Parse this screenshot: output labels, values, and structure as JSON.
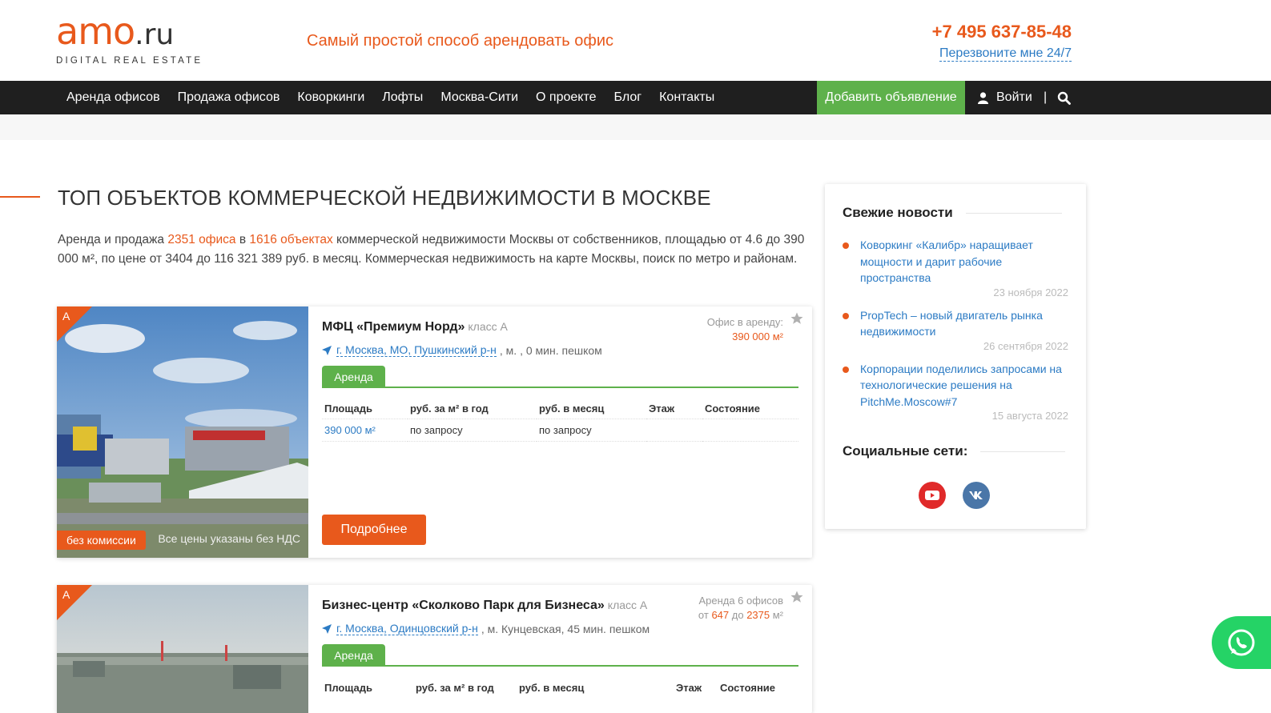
{
  "header": {
    "logo_main": "amo",
    "logo_ru": ".ru",
    "logo_sub": "DIGITAL REAL ESTATE",
    "slogan": "Самый простой способ арендовать офис",
    "phone": "+7 495 637-85-48",
    "callback": "Перезвоните мне 24/7"
  },
  "nav": {
    "items": [
      "Аренда офисов",
      "Продажа офисов",
      "Коворкинги",
      "Лофты",
      "Москва-Сити",
      "О проекте",
      "Блог",
      "Контакты"
    ],
    "add_listing": "Добавить объявление",
    "login": "Войти",
    "separator": "|"
  },
  "main": {
    "title": "ТОП ОБЪЕКТОВ КОММЕРЧЕСКОЙ НЕДВИЖИМОСТИ В МОСКВЕ",
    "intro_1": "Аренда и продажа ",
    "intro_offices": "2351 офиса",
    "intro_2": " в ",
    "intro_objects": "1616 объектах",
    "intro_3": " коммерческой недвижимости Москвы от собственников, площадью от 4.6 до 390 000 м², по цене от 3404 до 116 321 389 руб. в месяц. Коммерческая недвижимость на карте Москвы, поиск по метро и районам."
  },
  "listings": [
    {
      "class_letter": "A",
      "name": "МФЦ «Премиум Норд»",
      "class_label": "класс А",
      "address": "г. Москва, МО, Пушкинский р-н",
      "metro": ", м. , 0 мин. пешком",
      "offer_label": "Офис в аренду:",
      "offer_value": "390 000 м²",
      "tab": "Аренда",
      "columns": [
        "Площадь",
        "руб. за м² в год",
        "руб. в месяц",
        "Этаж",
        "Состояние"
      ],
      "row": [
        "390 000 м²",
        "по запросу",
        "по запросу",
        "",
        ""
      ],
      "no_commission": "без комиссии",
      "no_vat": "Все цены указаны без НДС",
      "more": "Подробнее"
    },
    {
      "class_letter": "A",
      "name": "Бизнес-центр «Сколково Парк для Бизнеса»",
      "class_label": "класс А",
      "address": "г. Москва, Одинцовский р-н",
      "metro": ", м. Кунцевская, 45 мин. пешком",
      "offer_label": "Аренда 6 офисов",
      "offer_from": "от ",
      "offer_min": "647",
      "offer_to": " до ",
      "offer_max": "2375",
      "offer_unit": " м²",
      "tab": "Аренда",
      "columns": [
        "Площадь",
        "руб. за м² в год",
        "руб. в месяц",
        "Этаж",
        "Состояние"
      ]
    }
  ],
  "sidebar": {
    "news_title": "Свежие новости",
    "news": [
      {
        "title": "Коворкинг «Калибр» наращивает мощности и дарит рабочие пространства",
        "date": "23 ноября 2022"
      },
      {
        "title": "PropTech – новый двигатель рынка недвижимости",
        "date": "26 сентября 2022"
      },
      {
        "title": "Корпорации поделились запросами на технологические решения на PitchMe.Moscow#7",
        "date": "15 августа 2022"
      }
    ],
    "social_title": "Социальные сети:",
    "social": [
      "youtube-icon",
      "vk-icon"
    ]
  },
  "colors": {
    "accent": "#e8591c",
    "green": "#5eb14b",
    "link": "#2c7bc4",
    "nav_bg": "#1f1f1f"
  }
}
